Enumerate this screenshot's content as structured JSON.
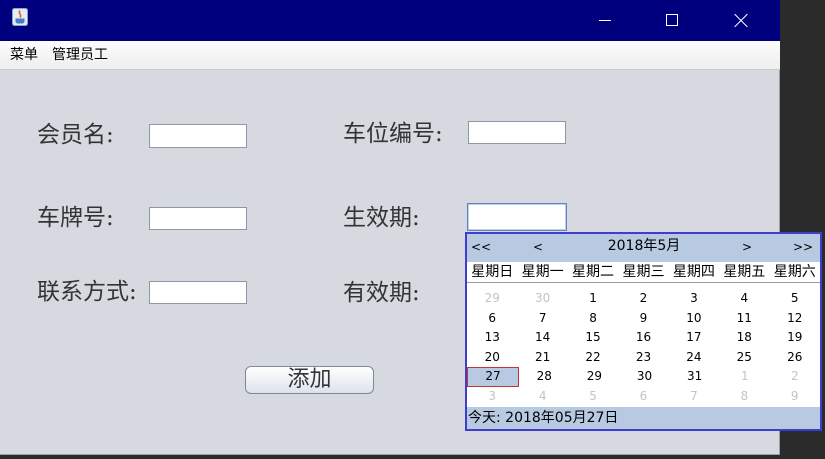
{
  "colors": {
    "title_bar": "#00007f",
    "desktop": "#2b2b2b",
    "content_bg": "#d6d9df",
    "menu_bar_bg": "#eeeeee",
    "calendar_border": "#3d3dcf",
    "calendar_band": "#b8c9e2",
    "selected_day_border": "#c83232",
    "other_month_text": "#c4c4c4",
    "focus_border": "#6382bf"
  },
  "window": {
    "icons": {
      "app": "java-app-icon",
      "minimize": "minimize-icon",
      "maximize": "maximize-icon",
      "close": "close-icon"
    }
  },
  "menu_bar": {
    "items": [
      {
        "label": "菜单"
      },
      {
        "label": "管理员工"
      }
    ]
  },
  "form": {
    "member_name": {
      "label": "会员名:",
      "value": ""
    },
    "parking_space_no": {
      "label": "车位编号:",
      "value": ""
    },
    "plate_no": {
      "label": "车牌号:",
      "value": ""
    },
    "effective_date": {
      "label": "生效期:",
      "value": ""
    },
    "contact": {
      "label": "联系方式:",
      "value": ""
    },
    "valid_period": {
      "label": "有效期:",
      "value": ""
    },
    "add_button_label": "添加"
  },
  "date_picker": {
    "nav": {
      "prev_year": "<<",
      "prev_month": "<",
      "month_title": "2018年5月",
      "next_month": ">",
      "next_year": ">>"
    },
    "weekdays": [
      "星期日",
      "星期一",
      "星期二",
      "星期三",
      "星期四",
      "星期五",
      "星期六"
    ],
    "weeks": [
      [
        {
          "day": "29",
          "other_month": true
        },
        {
          "day": "30",
          "other_month": true
        },
        {
          "day": "1"
        },
        {
          "day": "2"
        },
        {
          "day": "3"
        },
        {
          "day": "4"
        },
        {
          "day": "5"
        }
      ],
      [
        {
          "day": "6"
        },
        {
          "day": "7"
        },
        {
          "day": "8"
        },
        {
          "day": "9"
        },
        {
          "day": "10"
        },
        {
          "day": "11"
        },
        {
          "day": "12"
        }
      ],
      [
        {
          "day": "13"
        },
        {
          "day": "14"
        },
        {
          "day": "15"
        },
        {
          "day": "16"
        },
        {
          "day": "17"
        },
        {
          "day": "18"
        },
        {
          "day": "19"
        }
      ],
      [
        {
          "day": "20"
        },
        {
          "day": "21"
        },
        {
          "day": "22"
        },
        {
          "day": "23"
        },
        {
          "day": "24"
        },
        {
          "day": "25"
        },
        {
          "day": "26"
        }
      ],
      [
        {
          "day": "27",
          "selected": true
        },
        {
          "day": "28"
        },
        {
          "day": "29"
        },
        {
          "day": "30"
        },
        {
          "day": "31"
        },
        {
          "day": "1",
          "other_month": true
        },
        {
          "day": "2",
          "other_month": true
        }
      ],
      [
        {
          "day": "3",
          "other_month": true
        },
        {
          "day": "4",
          "other_month": true
        },
        {
          "day": "5",
          "other_month": true
        },
        {
          "day": "6",
          "other_month": true
        },
        {
          "day": "7",
          "other_month": true
        },
        {
          "day": "8",
          "other_month": true
        },
        {
          "day": "9",
          "other_month": true
        }
      ]
    ],
    "today_label": "今天: 2018年05月27日"
  }
}
